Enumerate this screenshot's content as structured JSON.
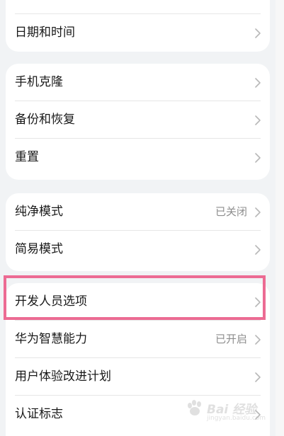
{
  "groups": [
    {
      "items": [
        {
          "label": "日期和时间",
          "value": ""
        }
      ]
    },
    {
      "items": [
        {
          "label": "手机克隆",
          "value": ""
        },
        {
          "label": "备份和恢复",
          "value": ""
        },
        {
          "label": "重置",
          "value": ""
        }
      ]
    },
    {
      "items": [
        {
          "label": "纯净模式",
          "value": "已关闭"
        },
        {
          "label": "简易模式",
          "value": ""
        }
      ]
    },
    {
      "items": [
        {
          "label": "开发人员选项",
          "value": ""
        },
        {
          "label": "华为智慧能力",
          "value": "已开启"
        },
        {
          "label": "用户体验改进计划",
          "value": ""
        },
        {
          "label": "认证标志",
          "value": ""
        }
      ]
    }
  ],
  "icons": {
    "chevron": "chevron-right-icon"
  },
  "colors": {
    "background": "#f1f3f5",
    "card": "#ffffff",
    "highlight_border": "#ec6b93",
    "secondary_text": "#8d8d8d"
  },
  "watermark": {
    "main": "Bai 经验",
    "sub": "jingyan.baidu.com"
  }
}
